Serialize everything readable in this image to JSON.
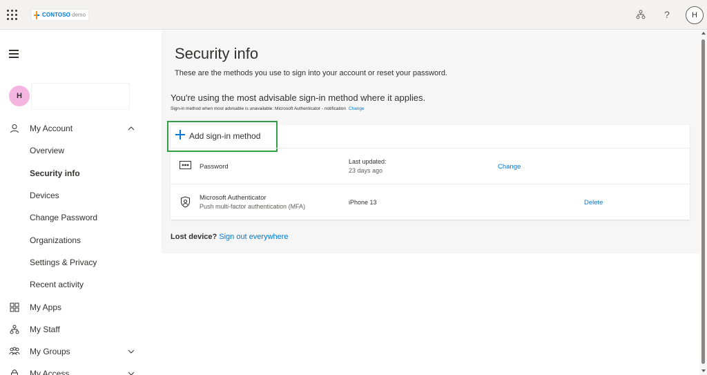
{
  "header": {
    "brand_name": "CONTOSO",
    "brand_suffix": "demo",
    "user_initial": "H",
    "help_symbol": "?",
    "icons": [
      "waffle-icon",
      "org-chart-icon",
      "help-icon"
    ],
    "colors": {
      "brand": "#0078d4",
      "logo_orange": "#f7941d"
    }
  },
  "sidebar": {
    "user_initial": "H",
    "avatar_color": "#f4b6e0",
    "items": [
      {
        "label": "My Account",
        "icon": "person-icon",
        "chevron": "up"
      },
      {
        "label": "Overview",
        "sub": true
      },
      {
        "label": "Security info",
        "sub": true,
        "active": true
      },
      {
        "label": "Devices",
        "sub": true
      },
      {
        "label": "Change Password",
        "sub": true
      },
      {
        "label": "Organizations",
        "sub": true
      },
      {
        "label": "Settings & Privacy",
        "sub": true
      },
      {
        "label": "Recent activity",
        "sub": true
      },
      {
        "label": "My Apps",
        "icon": "apps-icon"
      },
      {
        "label": "My Staff",
        "icon": "staff-icon"
      },
      {
        "label": "My Groups",
        "icon": "groups-icon",
        "chevron": "down"
      },
      {
        "label": "My Access",
        "icon": "lock-icon",
        "chevron": "down"
      }
    ]
  },
  "main": {
    "title": "Security info",
    "subtitle": "These are the methods you use to sign into your account or reset your password.",
    "advise_title": "You're using the most advisable sign-in method where it applies.",
    "advise_sub": "Sign-in method when most advisable is unavailable: Microsoft Authenticator - notification",
    "advise_change": "Change",
    "add_method_label": "Add sign-in method",
    "methods": [
      {
        "name": "Password",
        "icon": "password-dots-icon",
        "col2_line1": "Last updated:",
        "col2_line2": "23 days ago",
        "action": "Change"
      },
      {
        "name": "Microsoft Authenticator",
        "description": "Push multi-factor authentication (MFA)",
        "icon": "authenticator-icon",
        "col2_line1": "iPhone 13",
        "action": "Delete"
      }
    ],
    "lost_device_label": "Lost device?",
    "sign_out_everywhere": "Sign out everywhere",
    "colors": {
      "link": "#0078d4",
      "highlight_border": "#2ea043",
      "background": "#f6f6f6"
    }
  }
}
